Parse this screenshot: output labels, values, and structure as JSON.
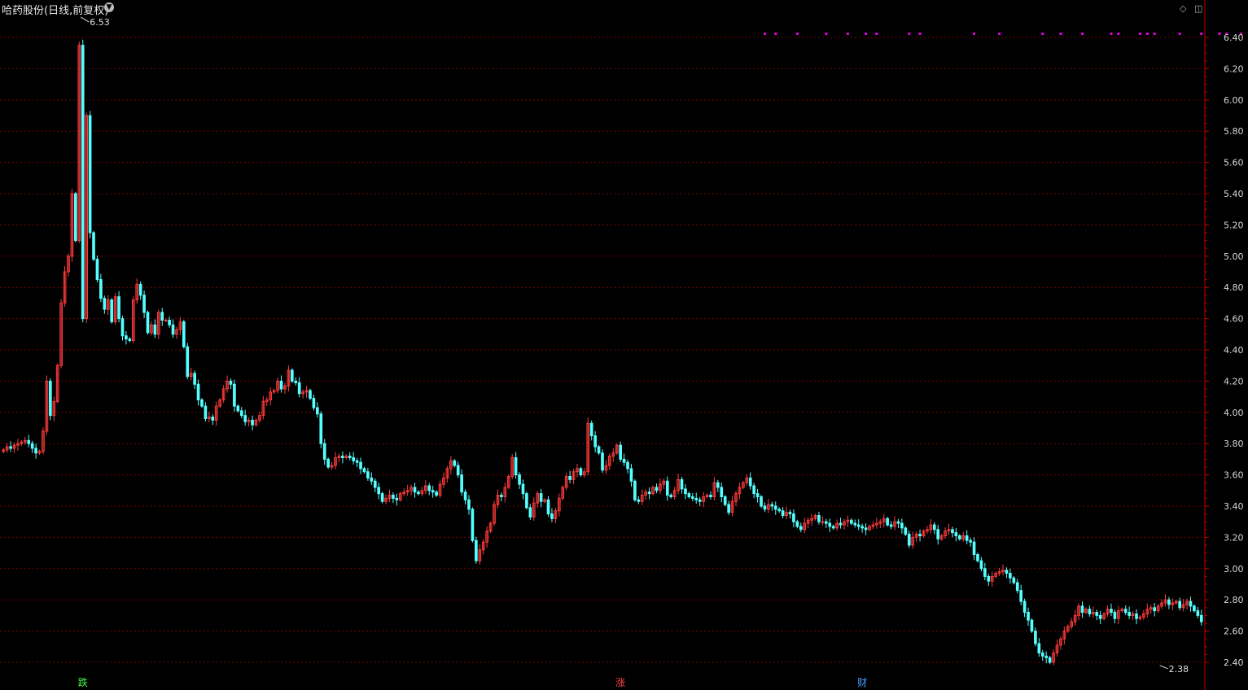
{
  "header": {
    "title": "哈药股份(日线,前复权)",
    "dropdown_icon": "chevron-down-icon",
    "icons": [
      "diamond-icon",
      "panel-toggle-icon"
    ]
  },
  "colors": {
    "up": "#ff3b3b",
    "down": "#54ffff",
    "grid": "#7a0000",
    "axis": "#c00000",
    "tick_text": "#d8d8d8",
    "dots": "#e000e0",
    "marker_down": "#44ff44",
    "marker_up": "#ff4444",
    "marker_fin": "#4aa0ff"
  },
  "chart_data": {
    "type": "candlestick",
    "title": "哈药股份(日线,前复权)",
    "y_ticks": [
      "6.40",
      "6.20",
      "6.00",
      "5.80",
      "5.60",
      "5.40",
      "5.20",
      "5.00",
      "4.80",
      "4.60",
      "4.40",
      "4.20",
      "4.00",
      "3.80",
      "3.60",
      "3.40",
      "3.20",
      "3.00",
      "2.80",
      "2.60",
      "2.40"
    ],
    "ylim": [
      2.38,
      6.53
    ],
    "grid": true,
    "annotations": [
      {
        "text": "6.53",
        "value": 6.53,
        "bar": 21
      },
      {
        "text": "2.38",
        "value": 2.38,
        "bar": 320
      }
    ],
    "bottom_markers": [
      {
        "text": "跌",
        "bar": 22,
        "kind": "down"
      },
      {
        "text": "涨",
        "bar": 171,
        "kind": "up"
      },
      {
        "text": "财",
        "bar": 238,
        "kind": "fin"
      }
    ],
    "dot_bars": [
      211,
      214,
      220,
      228,
      234,
      239,
      242,
      251,
      254,
      269,
      276,
      288,
      293,
      299,
      307,
      309,
      315,
      317,
      319,
      326,
      332,
      337,
      339,
      343,
      352,
      361,
      365,
      376,
      380,
      387,
      392,
      395,
      401,
      412
    ],
    "closes": [
      3.76,
      3.78,
      3.77,
      3.79,
      3.8,
      3.81,
      3.82,
      3.8,
      3.77,
      3.74,
      3.75,
      3.88,
      4.2,
      3.98,
      4.07,
      4.3,
      4.7,
      4.9,
      5.0,
      5.4,
      5.1,
      6.35,
      4.6,
      5.9,
      5.15,
      4.98,
      4.85,
      4.73,
      4.66,
      4.72,
      4.58,
      4.74,
      4.6,
      4.49,
      4.47,
      4.46,
      4.72,
      4.82,
      4.75,
      4.64,
      4.51,
      4.56,
      4.5,
      4.64,
      4.59,
      4.59,
      4.56,
      4.5,
      4.53,
      4.58,
      4.42,
      4.23,
      4.25,
      4.18,
      4.08,
      4.04,
      3.96,
      3.97,
      3.95,
      4.04,
      4.08,
      4.15,
      4.2,
      4.18,
      4.04,
      4.01,
      3.98,
      3.94,
      3.95,
      3.92,
      3.95,
      3.98,
      4.07,
      4.08,
      4.13,
      4.14,
      4.2,
      4.15,
      4.17,
      4.27,
      4.2,
      4.19,
      4.12,
      4.13,
      4.14,
      4.09,
      4.03,
      3.99,
      3.8,
      3.7,
      3.65,
      3.66,
      3.71,
      3.72,
      3.71,
      3.72,
      3.71,
      3.69,
      3.68,
      3.64,
      3.62,
      3.58,
      3.56,
      3.52,
      3.48,
      3.43,
      3.45,
      3.47,
      3.45,
      3.44,
      3.48,
      3.49,
      3.5,
      3.52,
      3.49,
      3.48,
      3.5,
      3.53,
      3.5,
      3.49,
      3.47,
      3.54,
      3.58,
      3.64,
      3.69,
      3.66,
      3.6,
      3.49,
      3.44,
      3.38,
      3.18,
      3.05,
      3.12,
      3.17,
      3.24,
      3.29,
      3.41,
      3.47,
      3.46,
      3.52,
      3.59,
      3.71,
      3.6,
      3.54,
      3.48,
      3.39,
      3.33,
      3.42,
      3.48,
      3.43,
      3.44,
      3.35,
      3.32,
      3.37,
      3.45,
      3.52,
      3.59,
      3.57,
      3.62,
      3.64,
      3.6,
      3.62,
      3.93,
      3.85,
      3.78,
      3.74,
      3.63,
      3.66,
      3.72,
      3.74,
      3.79,
      3.7,
      3.68,
      3.64,
      3.56,
      3.44,
      3.43,
      3.47,
      3.49,
      3.48,
      3.52,
      3.5,
      3.54,
      3.56,
      3.47,
      3.46,
      3.5,
      3.57,
      3.51,
      3.48,
      3.46,
      3.45,
      3.44,
      3.43,
      3.46,
      3.47,
      3.46,
      3.55,
      3.52,
      3.46,
      3.41,
      3.36,
      3.43,
      3.48,
      3.52,
      3.55,
      3.58,
      3.53,
      3.48,
      3.46,
      3.4,
      3.38,
      3.41,
      3.4,
      3.38,
      3.37,
      3.34,
      3.36,
      3.35,
      3.3,
      3.27,
      3.25,
      3.29,
      3.31,
      3.32,
      3.34,
      3.3,
      3.3,
      3.29,
      3.27,
      3.26,
      3.29,
      3.28,
      3.3,
      3.31,
      3.29,
      3.28,
      3.27,
      3.26,
      3.25,
      3.27,
      3.28,
      3.29,
      3.3,
      3.32,
      3.28,
      3.27,
      3.3,
      3.29,
      3.26,
      3.22,
      3.15,
      3.2,
      3.22,
      3.21,
      3.24,
      3.25,
      3.28,
      3.25,
      3.19,
      3.21,
      3.24,
      3.25,
      3.23,
      3.21,
      3.19,
      3.21,
      3.18,
      3.17,
      3.09,
      3.05,
      3.0,
      2.95,
      2.92,
      2.95,
      2.97,
      2.98,
      2.99,
      2.97,
      2.94,
      2.91,
      2.86,
      2.79,
      2.72,
      2.67,
      2.6,
      2.52,
      2.46,
      2.44,
      2.43,
      2.4,
      2.46,
      2.51,
      2.55,
      2.6,
      2.63,
      2.66,
      2.7,
      2.76,
      2.72,
      2.74,
      2.71,
      2.72,
      2.7,
      2.68,
      2.71,
      2.74,
      2.72,
      2.68,
      2.73,
      2.74,
      2.72,
      2.7,
      2.71,
      2.68,
      2.69,
      2.71,
      2.74,
      2.75,
      2.73,
      2.76,
      2.78,
      2.8,
      2.77,
      2.78,
      2.79,
      2.75,
      2.77,
      2.79,
      2.76,
      2.73,
      2.7,
      2.66
    ]
  }
}
